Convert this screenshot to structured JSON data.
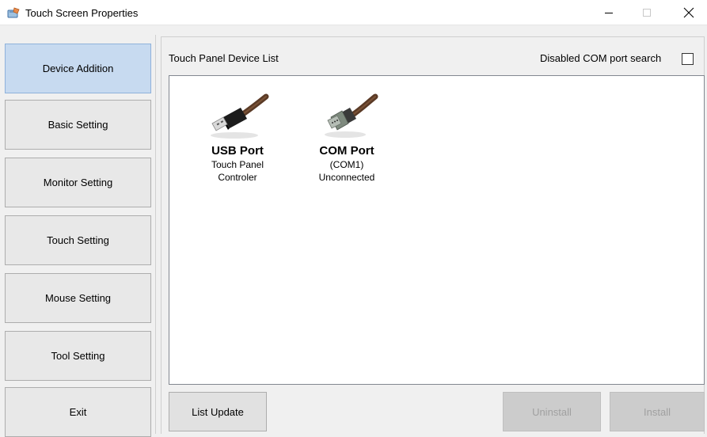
{
  "window": {
    "title": "Touch Screen Properties",
    "app_icon": "touch-screen-app-icon",
    "controls": {
      "minimize": "minimize-icon",
      "maximize": "maximize-icon",
      "close": "close-icon"
    }
  },
  "sidebar": {
    "items": [
      {
        "label": "Device Addition",
        "active": true
      },
      {
        "label": "Basic Setting",
        "active": false
      },
      {
        "label": "Monitor Setting",
        "active": false
      },
      {
        "label": "Touch Setting",
        "active": false
      },
      {
        "label": "Mouse Setting",
        "active": false
      },
      {
        "label": "Tool Setting",
        "active": false
      },
      {
        "label": "Exit",
        "active": false
      }
    ]
  },
  "main": {
    "list_label": "Touch Panel Device List",
    "com_search_label": "Disabled COM port search",
    "com_search_checked": false,
    "devices": [
      {
        "name": "USB Port",
        "line1": "Touch Panel",
        "line2": "Controler",
        "icon": "usb-cable-icon"
      },
      {
        "name": "COM Port",
        "line1": "(COM1)",
        "line2": "Unconnected",
        "icon": "com-cable-icon"
      }
    ],
    "buttons": {
      "list_update": "List Update",
      "uninstall": "Uninstall",
      "install": "Install"
    }
  },
  "colors": {
    "active_sidebar": "#c7daf0",
    "cable": "#5a3a26"
  }
}
